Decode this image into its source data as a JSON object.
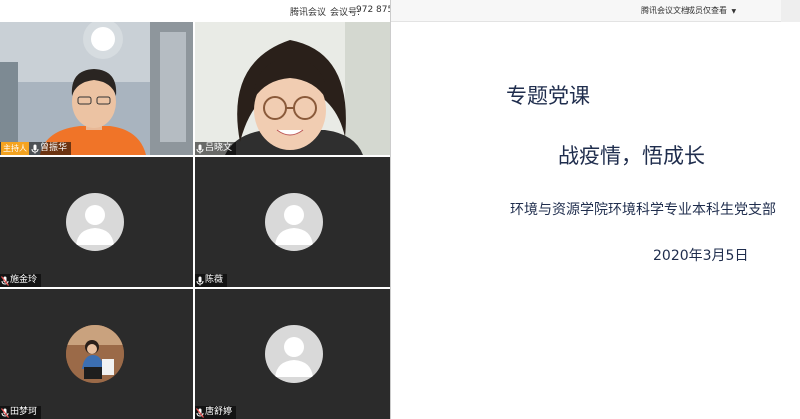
{
  "meeting": {
    "app_name": "腾讯会议",
    "meeting_id_label": "会议号:",
    "meeting_id": "972 875"
  },
  "participants": [
    {
      "name": "曾振华",
      "role": "主持人",
      "mic": "on",
      "video": true
    },
    {
      "name": "吕晓文",
      "mic": "on",
      "video": true
    },
    {
      "name": "施金玲",
      "mic": "off",
      "video": false
    },
    {
      "name": "陈薇",
      "mic": "on",
      "video": false
    },
    {
      "name": "田梦珂",
      "mic": "off",
      "video": false
    },
    {
      "name": "唐舒婷",
      "mic": "off",
      "video": false
    }
  ],
  "shared_doc": {
    "app_label": "腾讯会议文档",
    "permission_label": "成员仅查看"
  },
  "slide": {
    "title": "专题党课",
    "subtitle": "战疫情，悟成长",
    "organization": "环境与资源学院环境科学专业本科生党支部",
    "date": "2020年3月5日"
  },
  "colors": {
    "host_badge": "#f4a320",
    "slide_text": "#1f2d4d",
    "tile_bg": "#2b2b2b"
  }
}
